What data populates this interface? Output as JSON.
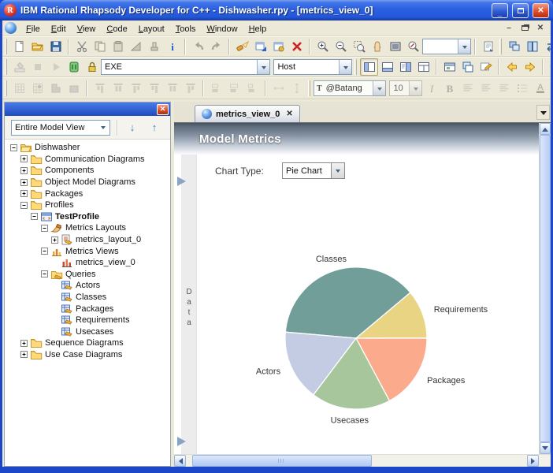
{
  "window": {
    "title": "IBM Rational Rhapsody Developer for C++ - Dishwasher.rpy - [metrics_view_0]",
    "controls": {
      "minimize": "-",
      "maximize": "",
      "close": "X"
    }
  },
  "menubar": {
    "items": [
      "File",
      "Edit",
      "View",
      "Code",
      "Layout",
      "Tools",
      "Window",
      "Help"
    ]
  },
  "toolbars": {
    "standard": {
      "groups": [
        [
          "new-file",
          "open-model",
          "save"
        ],
        [
          "cut",
          "copy",
          "paste",
          "reroute-line",
          "format-tool",
          "element-info"
        ],
        [
          "undo",
          "redo"
        ],
        [
          "search-flashlight",
          "goto-diagram",
          "report-tool",
          "delete-from-model"
        ],
        [
          "zoom-in",
          "zoom-out",
          "zoom-area",
          "pan-hand",
          "fit-to-window",
          "zoom-custom"
        ]
      ],
      "zoom_combo_value": "",
      "tail_groups": [
        [
          "page-setup"
        ],
        [
          "cascade-windows",
          "arrange-windows",
          "swap-windows",
          "navigate-person",
          "show-target",
          "more-windows"
        ]
      ]
    },
    "execution": {
      "left_icons": [
        "~build",
        "~stop",
        "~run",
        "make-target",
        "lock-model"
      ],
      "config_combo_value": "EXE",
      "host_combo_value": "Host",
      "right_groups": [
        [
          "browser-toggle*",
          "output-window",
          "features-window",
          "panes-window"
        ],
        [
          "diagram-views",
          "active-diagram",
          "customize-pencil"
        ],
        [
          "back-nav",
          "forward-nav"
        ],
        [
          "favorite-star",
          "favorite-star-2"
        ]
      ]
    },
    "format": {
      "left_icons": [
        "~grid",
        "~grid-snap",
        "~corner-shape",
        "~filled-shape"
      ],
      "align_icons": [
        "~align-top",
        "~align-middle",
        "~align-bottom",
        "~align-left-edge",
        "~align-center-edge",
        "~align-right-edge"
      ],
      "size_icons": [
        "~same-width",
        "~same-height",
        "~same-size"
      ],
      "space_icons": [
        "~space-horizontal",
        "~space-vertical"
      ],
      "font_combo_value": "@Batang",
      "size_combo_value": "10",
      "text_icons": [
        "~italic",
        "~bold",
        "~para-left",
        "~para-center",
        "~para-right",
        "~list-format",
        "~font-color",
        "~line-color",
        "~fill-color"
      ]
    }
  },
  "browser_panel": {
    "view_selector_value": "Entire Model View",
    "tree": [
      {
        "label": "Dishwasher",
        "depth": 0,
        "expander": "minus",
        "icon": "folder-open",
        "bold": false
      },
      {
        "label": "Communication Diagrams",
        "depth": 1,
        "expander": "plus",
        "icon": "folder",
        "bold": false
      },
      {
        "label": "Components",
        "depth": 1,
        "expander": "plus",
        "icon": "folder",
        "bold": false
      },
      {
        "label": "Object Model Diagrams",
        "depth": 1,
        "expander": "plus",
        "icon": "folder",
        "bold": false
      },
      {
        "label": "Packages",
        "depth": 1,
        "expander": "plus",
        "icon": "folder",
        "bold": false
      },
      {
        "label": "Profiles",
        "depth": 1,
        "expander": "minus",
        "icon": "folder",
        "bold": false
      },
      {
        "label": "TestProfile",
        "depth": 2,
        "expander": "minus",
        "icon": "profile",
        "bold": true
      },
      {
        "label": "Metrics Layouts",
        "depth": 3,
        "expander": "minus",
        "icon": "metrics-layouts",
        "bold": false
      },
      {
        "label": "metrics_layout_0",
        "depth": 4,
        "expander": "plus",
        "icon": "metrics-layout",
        "bold": false
      },
      {
        "label": "Metrics Views",
        "depth": 3,
        "expander": "minus",
        "icon": "metrics-views",
        "bold": false
      },
      {
        "label": "metrics_view_0",
        "depth": 4,
        "expander": "none",
        "icon": "metrics-view",
        "bold": false
      },
      {
        "label": "Queries",
        "depth": 3,
        "expander": "minus",
        "icon": "queries",
        "bold": false
      },
      {
        "label": "Actors",
        "depth": 4,
        "expander": "none",
        "icon": "query",
        "bold": false
      },
      {
        "label": "Classes",
        "depth": 4,
        "expander": "none",
        "icon": "query",
        "bold": false
      },
      {
        "label": "Packages",
        "depth": 4,
        "expander": "none",
        "icon": "query",
        "bold": false
      },
      {
        "label": "Requirements",
        "depth": 4,
        "expander": "none",
        "icon": "query",
        "bold": false
      },
      {
        "label": "Usecases",
        "depth": 4,
        "expander": "none",
        "icon": "query",
        "bold": false
      },
      {
        "label": "Sequence Diagrams",
        "depth": 1,
        "expander": "plus",
        "icon": "folder",
        "bold": false
      },
      {
        "label": "Use Case Diagrams",
        "depth": 1,
        "expander": "plus",
        "icon": "folder",
        "bold": false
      }
    ]
  },
  "editor": {
    "tab": {
      "label": "metrics_view_0"
    },
    "header_title": "Model Metrics",
    "chart_type_label": "Chart Type:",
    "chart_type_value": "Pie Chart",
    "data_panel_label": "Data"
  },
  "chart_data": {
    "type": "pie",
    "title": "Model Metrics",
    "labels": [
      "Classes",
      "Requirements",
      "Packages",
      "Usecases",
      "Actors"
    ],
    "values_percent": [
      37.5,
      11.1,
      17.2,
      18.1,
      16.1
    ],
    "colors": [
      "#719e99",
      "#e9d484",
      "#fbab8c",
      "#a8c69b",
      "#c3cce2"
    ],
    "label_color": "#333333",
    "start_angle_deg": 275,
    "legend": "labels-around-slices"
  }
}
